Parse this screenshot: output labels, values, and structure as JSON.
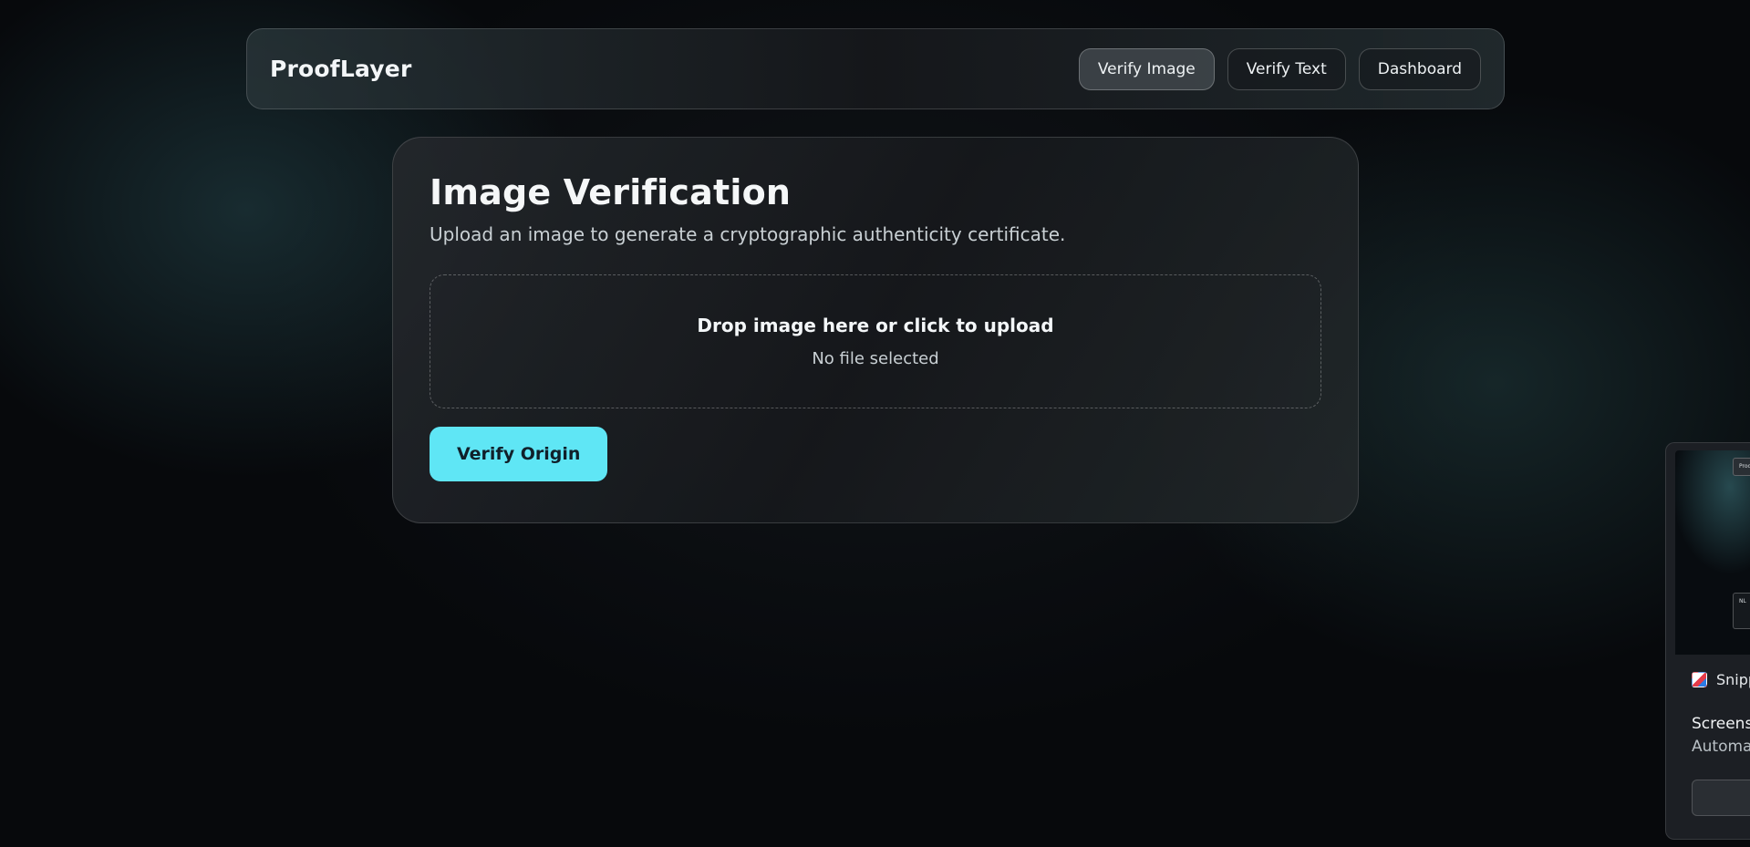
{
  "header": {
    "brand": "ProofLayer",
    "nav": [
      {
        "label": "Verify Image",
        "active": true
      },
      {
        "label": "Verify Text",
        "active": false
      },
      {
        "label": "Dashboard",
        "active": false
      }
    ]
  },
  "main": {
    "title": "Image Verification",
    "subtitle": "Upload an image to generate a cryptographic authenticity certificate.",
    "dropzone": {
      "prompt": "Drop image here or click to upload",
      "status": "No file selected"
    },
    "submit_label": "Verify Origin"
  },
  "notification": {
    "app_name": "Snipp",
    "title": "Screensh",
    "body": "Automat",
    "thumb_chip_top": "Proo",
    "thumb_chip_mid": "NL"
  },
  "colors": {
    "accent": "#5fe6f5",
    "background": "#07090c"
  }
}
